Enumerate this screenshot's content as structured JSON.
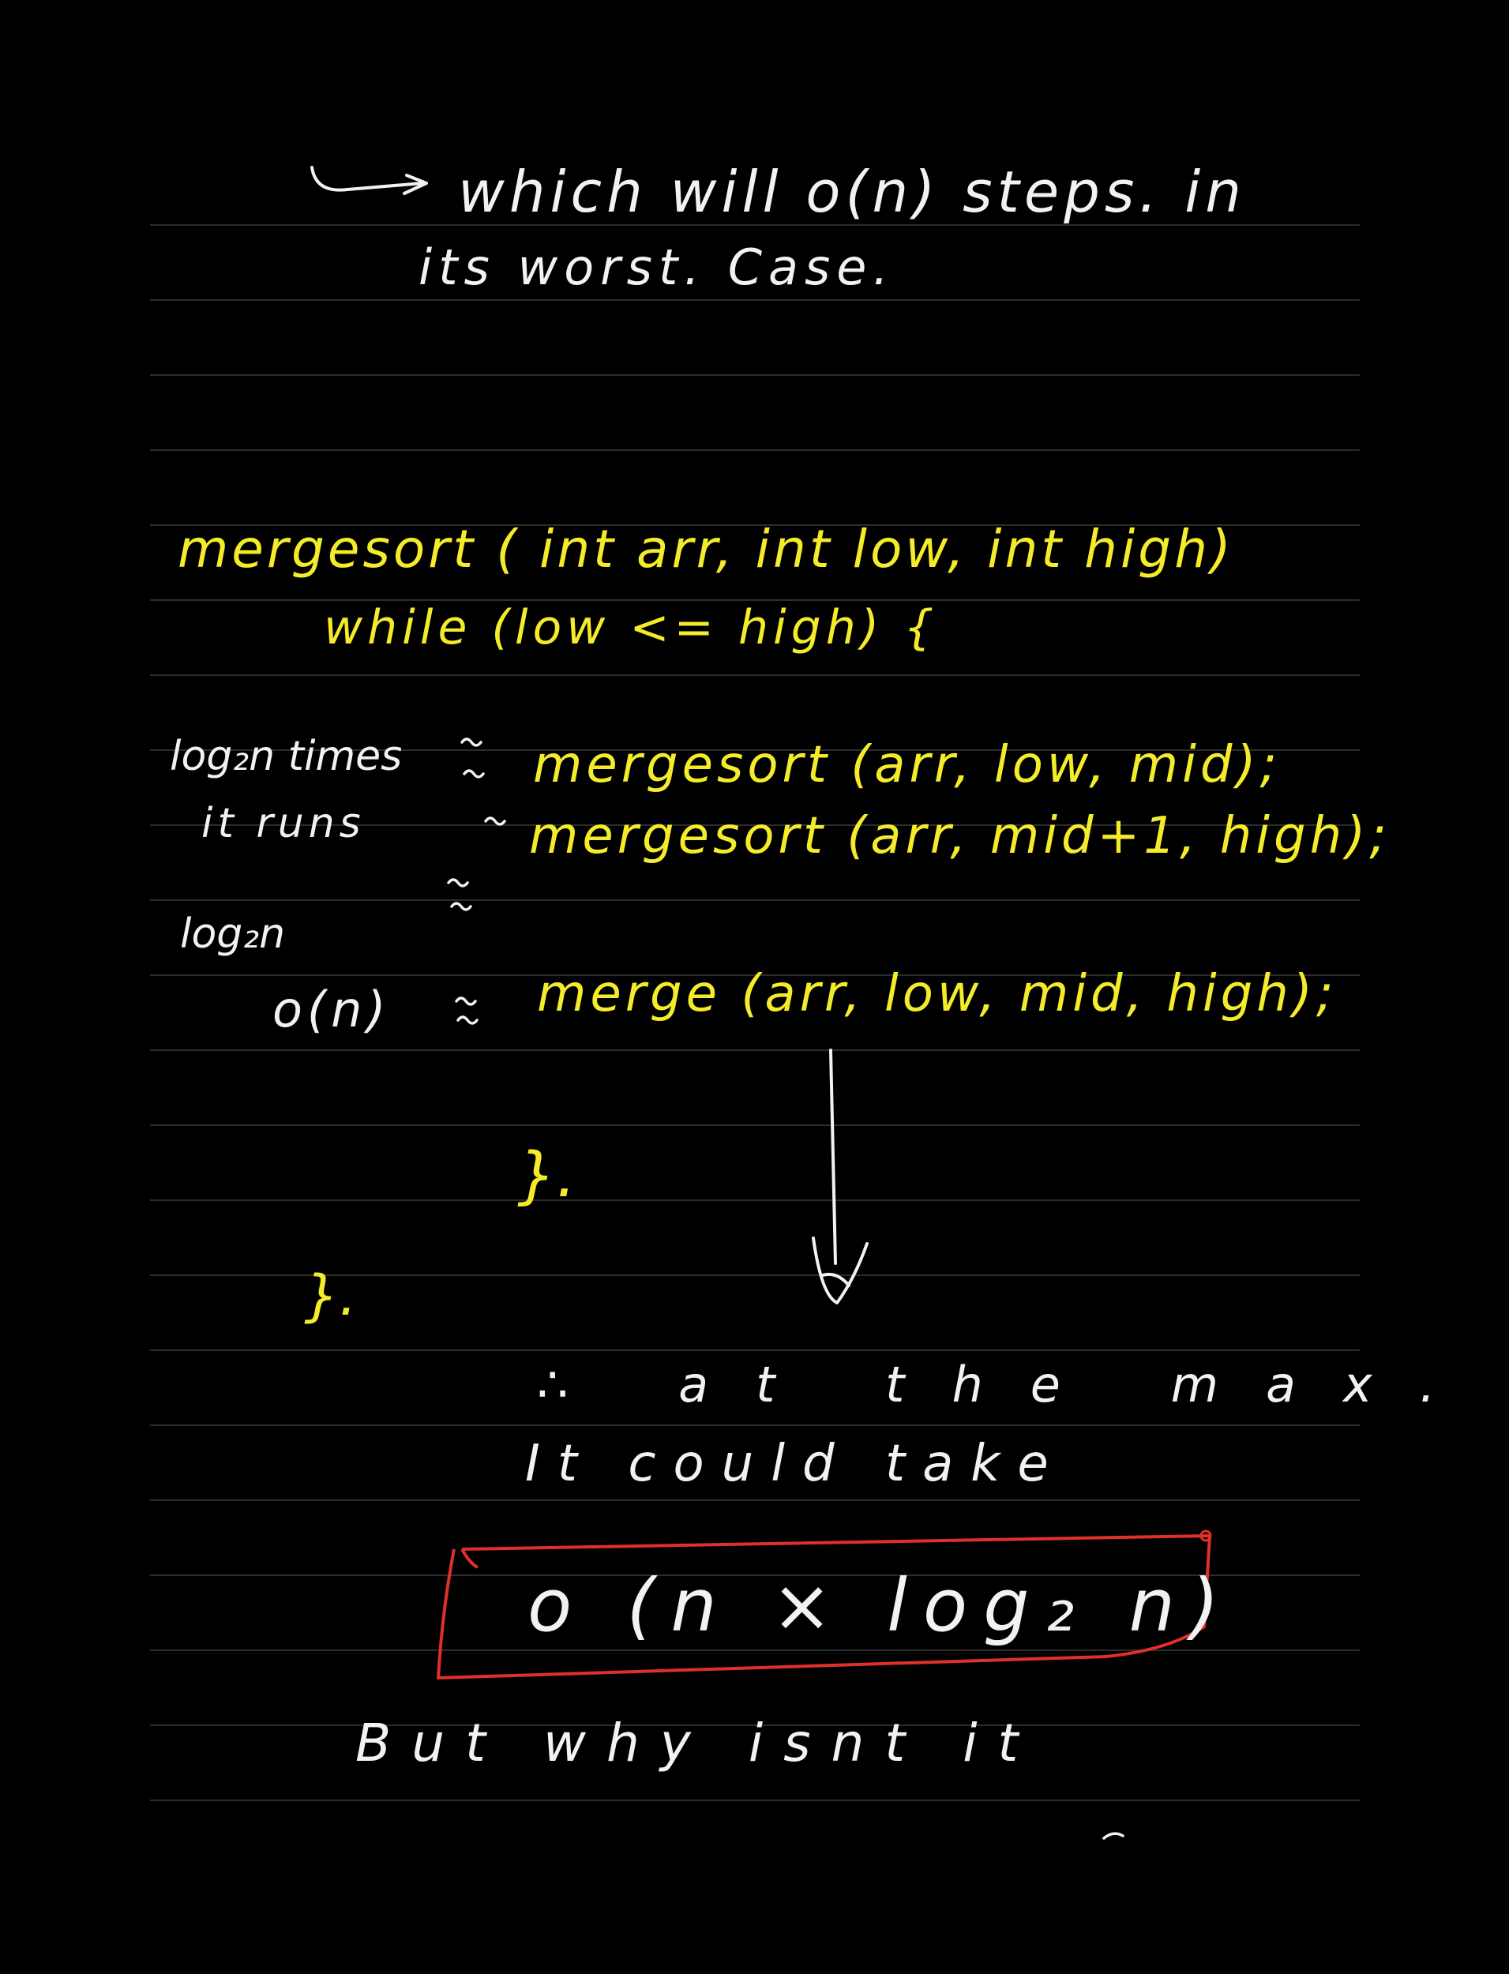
{
  "colors": {
    "background": "#000000",
    "rule_line": "#3a3a3a",
    "ink_white": "#f2f2f2",
    "ink_yellow": "#f4ec2a",
    "ink_red": "#e0302a"
  },
  "note": {
    "line1": "which will o(n) steps. in",
    "line2": "its worst. Case.",
    "code_signature": "mergesort ( int arr, int low, int high)",
    "code_while": "while (low <= high) {",
    "annot_times": "log₂n times",
    "annot_runs": "it runs",
    "code_call1": "mergesort (arr, low, mid);",
    "code_call2": "mergesort (arr, mid+1, high);",
    "annot_log": "log₂n",
    "annot_on": "o(n)",
    "code_merge": "merge (arr, low, mid, high);",
    "code_close": "}.",
    "brace_small": "}.",
    "conclusion1": "∴ at the max.",
    "conclusion2": "It could take",
    "boxed_result": "o (n × log₂ n)",
    "question": "But why isnt it"
  }
}
